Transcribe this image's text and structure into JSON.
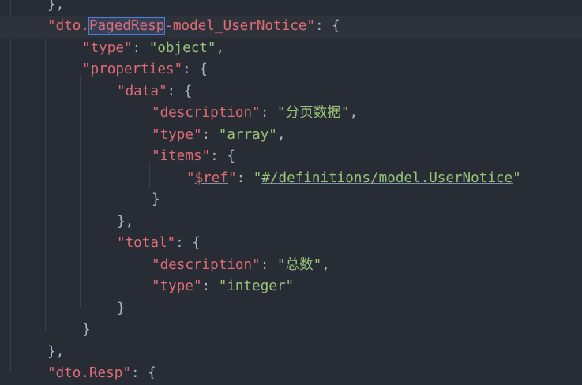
{
  "editor": {
    "current_line": 1,
    "lines": [
      {
        "indent": 1,
        "tokens": [
          {
            "t": "},",
            "c": "b"
          }
        ]
      },
      {
        "indent": 1,
        "tokens": [
          {
            "t": "\"dto.",
            "c": "k"
          },
          {
            "t": "PagedResp",
            "c": "k sel"
          },
          {
            "t": "-model_UserNotice\"",
            "c": "k"
          },
          {
            "t": ": ",
            "c": "p"
          },
          {
            "t": "{",
            "c": "b"
          }
        ]
      },
      {
        "indent": 2,
        "tokens": [
          {
            "t": "\"type\"",
            "c": "k"
          },
          {
            "t": ": ",
            "c": "p"
          },
          {
            "t": "\"object\"",
            "c": "s"
          },
          {
            "t": ",",
            "c": "p"
          }
        ]
      },
      {
        "indent": 2,
        "tokens": [
          {
            "t": "\"properties\"",
            "c": "k"
          },
          {
            "t": ": ",
            "c": "p"
          },
          {
            "t": "{",
            "c": "b"
          }
        ]
      },
      {
        "indent": 3,
        "tokens": [
          {
            "t": "\"data\"",
            "c": "k"
          },
          {
            "t": ": ",
            "c": "p"
          },
          {
            "t": "{",
            "c": "b"
          }
        ]
      },
      {
        "indent": 4,
        "tokens": [
          {
            "t": "\"description\"",
            "c": "k"
          },
          {
            "t": ": ",
            "c": "p"
          },
          {
            "t": "\"分页数据\"",
            "c": "s"
          },
          {
            "t": ",",
            "c": "p"
          }
        ]
      },
      {
        "indent": 4,
        "tokens": [
          {
            "t": "\"type\"",
            "c": "k"
          },
          {
            "t": ": ",
            "c": "p"
          },
          {
            "t": "\"array\"",
            "c": "s"
          },
          {
            "t": ",",
            "c": "p"
          }
        ]
      },
      {
        "indent": 4,
        "tokens": [
          {
            "t": "\"items\"",
            "c": "k"
          },
          {
            "t": ": ",
            "c": "p"
          },
          {
            "t": "{",
            "c": "b"
          }
        ]
      },
      {
        "indent": 5,
        "tokens": [
          {
            "t": "\"",
            "c": "k"
          },
          {
            "t": "$ref",
            "c": "k u"
          },
          {
            "t": "\"",
            "c": "k"
          },
          {
            "t": ": ",
            "c": "p"
          },
          {
            "t": "\"",
            "c": "s"
          },
          {
            "t": "#/definitions/model.UserNotice",
            "c": "s u"
          },
          {
            "t": "\"",
            "c": "s"
          }
        ]
      },
      {
        "indent": 4,
        "tokens": [
          {
            "t": "}",
            "c": "b"
          }
        ]
      },
      {
        "indent": 3,
        "tokens": [
          {
            "t": "},",
            "c": "b"
          }
        ]
      },
      {
        "indent": 3,
        "tokens": [
          {
            "t": "\"total\"",
            "c": "k"
          },
          {
            "t": ": ",
            "c": "p"
          },
          {
            "t": "{",
            "c": "b"
          }
        ]
      },
      {
        "indent": 4,
        "tokens": [
          {
            "t": "\"description\"",
            "c": "k"
          },
          {
            "t": ": ",
            "c": "p"
          },
          {
            "t": "\"总数\"",
            "c": "s"
          },
          {
            "t": ",",
            "c": "p"
          }
        ]
      },
      {
        "indent": 4,
        "tokens": [
          {
            "t": "\"type\"",
            "c": "k"
          },
          {
            "t": ": ",
            "c": "p"
          },
          {
            "t": "\"integer\"",
            "c": "s"
          }
        ]
      },
      {
        "indent": 3,
        "tokens": [
          {
            "t": "}",
            "c": "b"
          }
        ]
      },
      {
        "indent": 2,
        "tokens": [
          {
            "t": "}",
            "c": "b"
          }
        ]
      },
      {
        "indent": 1,
        "tokens": [
          {
            "t": "},",
            "c": "b"
          }
        ]
      },
      {
        "indent": 1,
        "tokens": [
          {
            "t": "\"dto.Resp\"",
            "c": "k"
          },
          {
            "t": ": ",
            "c": "p"
          },
          {
            "t": "{",
            "c": "b"
          }
        ]
      }
    ]
  }
}
